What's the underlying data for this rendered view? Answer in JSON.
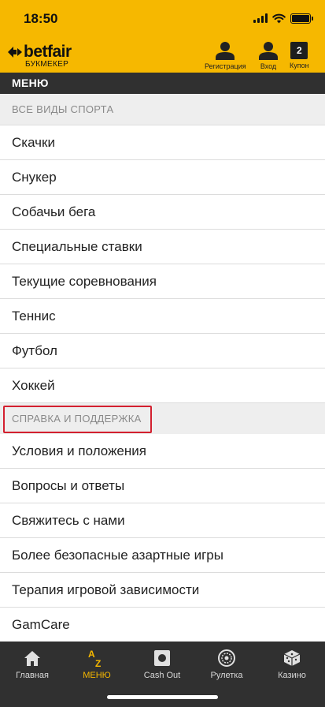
{
  "status": {
    "time": "18:50"
  },
  "header": {
    "logo": "betfair",
    "logo_sub": "БУКМЕКЕР",
    "register_label": "Регистрация",
    "login_label": "Вход",
    "coupon_count": "2",
    "coupon_label": "Купон",
    "accent_color": "#f6b800"
  },
  "menu": {
    "title": "МЕНЮ"
  },
  "sections": [
    {
      "title": "ВСЕ ВИДЫ СПОРТА",
      "items": [
        "Скачки",
        "Снукер",
        "Собачьи бега",
        "Специальные ставки",
        "Текущие соревнования",
        "Теннис",
        "Футбол",
        "Хоккей"
      ]
    },
    {
      "title": "СПРАВКА И ПОДДЕРЖКА",
      "items": [
        "Условия и положения",
        "Вопросы и ответы",
        "Свяжитесь с нами",
        "Более безопасные азартные игры",
        "Терапия игровой зависимости",
        "GamCare"
      ]
    }
  ],
  "tabs": [
    {
      "label": "Главная",
      "icon": "home-icon"
    },
    {
      "label": "МЕНЮ",
      "icon": "az-menu-icon",
      "active": true
    },
    {
      "label": "Cash Out",
      "icon": "cash-out-icon"
    },
    {
      "label": "Рулетка",
      "icon": "roulette-icon"
    },
    {
      "label": "Казино",
      "icon": "dice-icon"
    }
  ]
}
